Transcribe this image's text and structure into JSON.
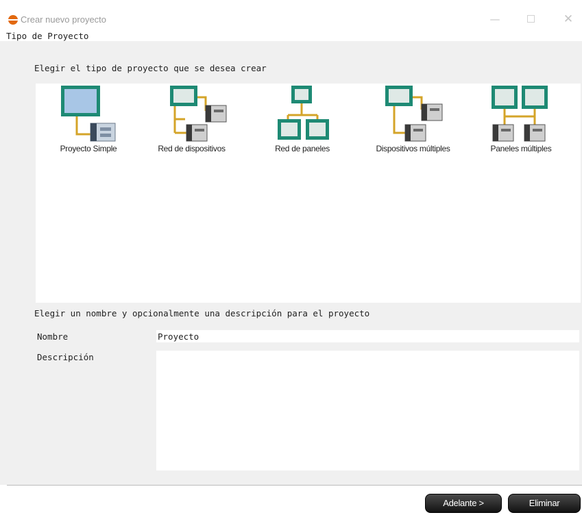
{
  "window": {
    "title": "Crear nuevo proyecto",
    "minimize": "—",
    "close": "✕"
  },
  "section": "Tipo de Proyecto",
  "project_type": {
    "prompt": "Elegir el tipo de proyecto que se desea crear",
    "options": [
      {
        "label": "Proyecto Simple",
        "icon": "single-panel-device-icon"
      },
      {
        "label": "Red de dispositivos",
        "icon": "device-network-icon"
      },
      {
        "label": "Red de paneles",
        "icon": "panel-network-icon"
      },
      {
        "label": "Dispositivos múltiples",
        "icon": "multiple-devices-icon"
      },
      {
        "label": "Paneles múltiples",
        "icon": "multiple-panels-icon"
      }
    ]
  },
  "details": {
    "prompt": "Elegir un nombre y opcionalmente una descripción para el proyecto",
    "name_label": "Nombre",
    "name_value": "Proyecto",
    "description_label": "Descripción",
    "description_value": ""
  },
  "buttons": {
    "next": "Adelante >",
    "delete": "Eliminar"
  },
  "colors": {
    "accent": "#e2690f",
    "panel_frame": "#1e8a74",
    "panel_screen": "#a8c6e6",
    "cable": "#d4a429",
    "button_dark": "#1a1a1a"
  }
}
